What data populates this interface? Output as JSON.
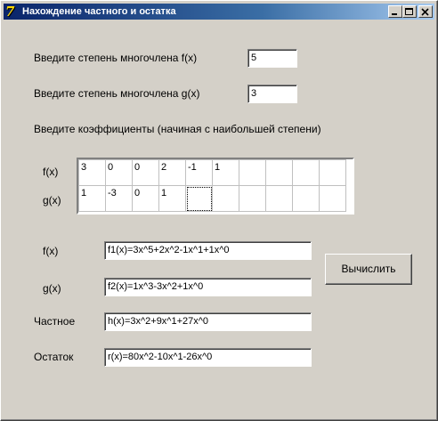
{
  "window": {
    "title": "Нахождение частного и остатка"
  },
  "inputs": {
    "degree_f_label": "Введите степень многочлена f(x)",
    "degree_f_value": "5",
    "degree_g_label": "Введите степень многочлена g(x)",
    "degree_g_value": "3",
    "coefficients_label": "Введите коэффициенты (начиная с наибольшей степени)"
  },
  "grid": {
    "row_labels": [
      "f(x)",
      "g(x)"
    ],
    "rows": [
      [
        "3",
        "0",
        "0",
        "2",
        "-1",
        "1",
        "",
        "",
        "",
        ""
      ],
      [
        "1",
        "-3",
        "0",
        "1",
        "",
        "",
        "",
        "",
        "",
        ""
      ]
    ]
  },
  "results": {
    "f_label": "f(x)",
    "f_value": "f1(x)=3x^5+2x^2-1x^1+1x^0",
    "g_label": "g(x)",
    "g_value": "f2(x)=1x^3-3x^2+1x^0",
    "quotient_label": "Частное",
    "quotient_value": "h(x)=3x^2+9x^1+27x^0",
    "remainder_label": "Остаток",
    "remainder_value": "r(x)=80x^2-10x^1-26x^0"
  },
  "buttons": {
    "calculate_label": "Вычислить"
  }
}
